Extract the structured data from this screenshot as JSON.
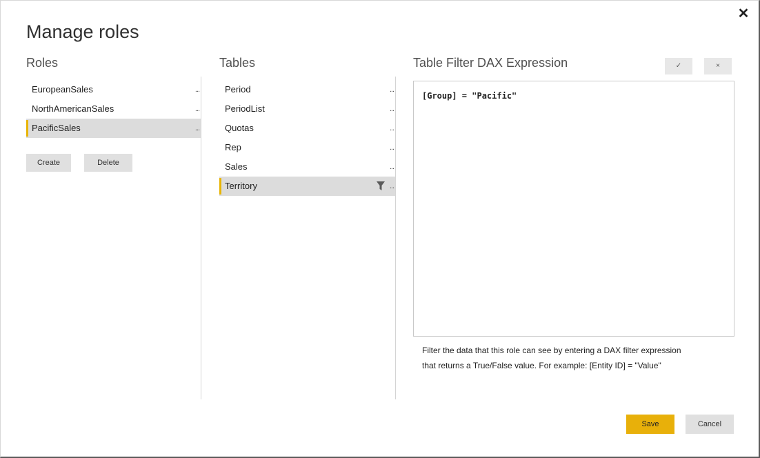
{
  "dialog": {
    "title": "Manage roles",
    "close_label": "✕"
  },
  "roles": {
    "header": "Roles",
    "items": [
      {
        "label": "EuropeanSales",
        "more": "..."
      },
      {
        "label": "NorthAmericanSales",
        "more": "..."
      },
      {
        "label": "PacificSales",
        "more": "...",
        "selected": true
      }
    ],
    "create_label": "Create",
    "delete_label": "Delete"
  },
  "tables": {
    "header": "Tables",
    "items": [
      {
        "label": "Period",
        "more": "..."
      },
      {
        "label": "PeriodList",
        "more": "..."
      },
      {
        "label": "Quotas",
        "more": "..."
      },
      {
        "label": "Rep",
        "more": "..."
      },
      {
        "label": "Sales",
        "more": "..."
      },
      {
        "label": "Territory",
        "more": "...",
        "selected": true,
        "icon": "filter-icon"
      }
    ]
  },
  "dax": {
    "header": "Table Filter DAX Expression",
    "confirm_label": "✓",
    "cancel_label": "×",
    "expression": "[Group] = \"Pacific\"",
    "hint_line1": "Filter the data that this role can see by entering a DAX filter expression",
    "hint_line2": "that returns a True/False value. For example: [Entity ID] = \"Value\""
  },
  "footer": {
    "save_label": "Save",
    "cancel_label": "Cancel"
  },
  "colors": {
    "accent": "#e8b00a",
    "selected_bg": "#dcdcdc",
    "button_gray": "#e0e0e0"
  }
}
